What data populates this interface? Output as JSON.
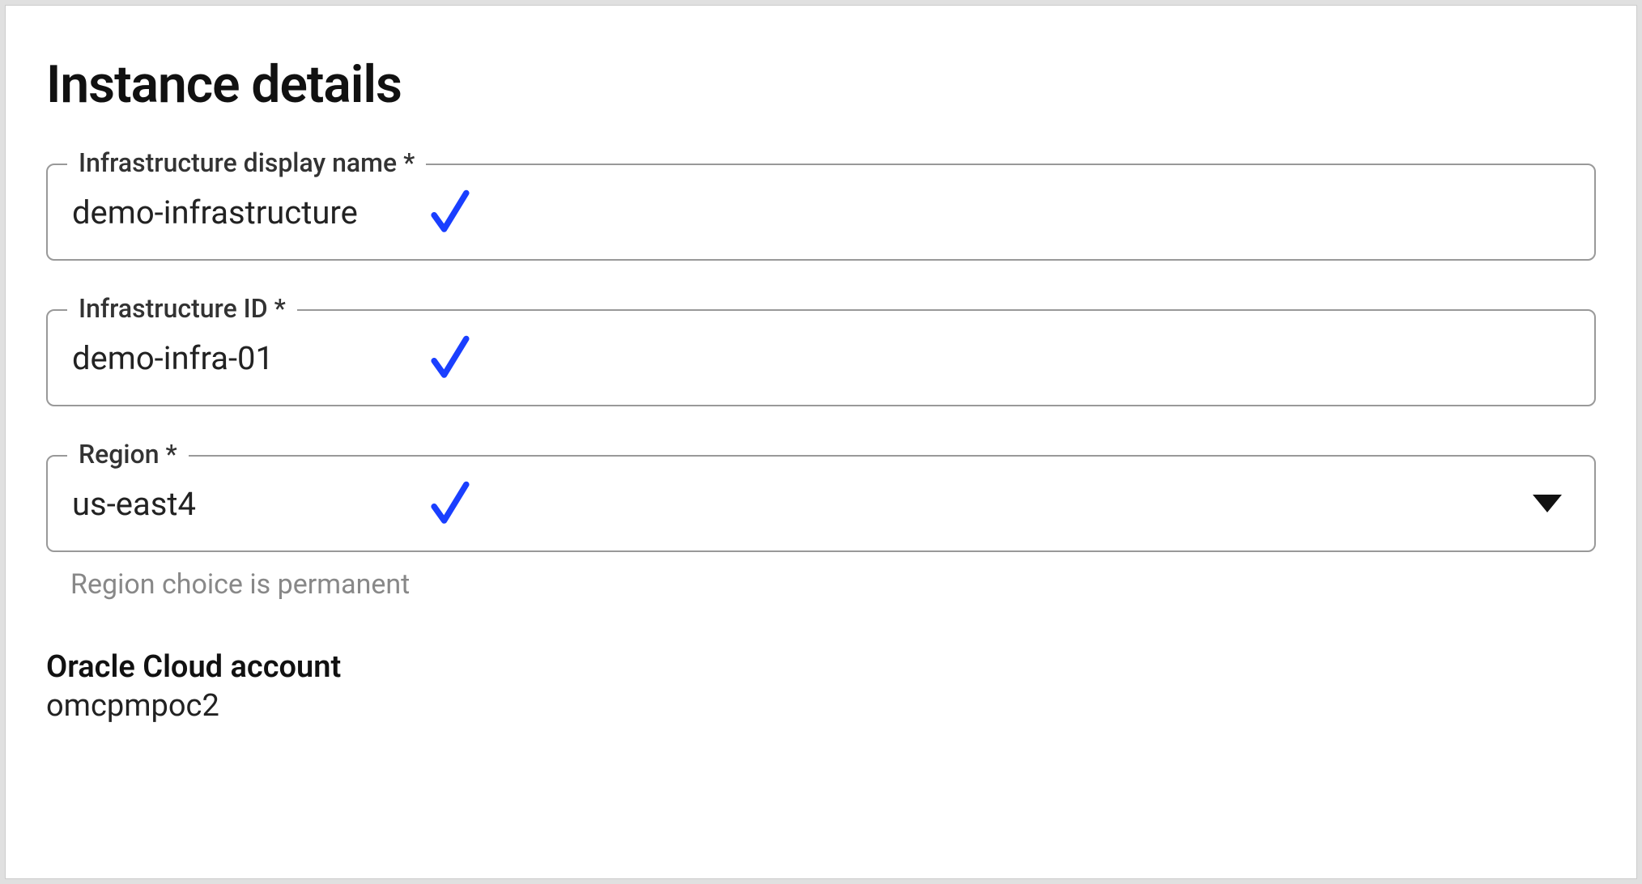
{
  "title": "Instance details",
  "fields": {
    "displayName": {
      "label": "Infrastructure display name *",
      "value": "demo-infrastructure"
    },
    "infraId": {
      "label": "Infrastructure ID *",
      "value": "demo-infra-01"
    },
    "region": {
      "label": "Region *",
      "value": "us-east4",
      "helper": "Region choice is permanent"
    }
  },
  "oracleAccount": {
    "label": "Oracle Cloud account",
    "value": "omcpmpoc2"
  }
}
